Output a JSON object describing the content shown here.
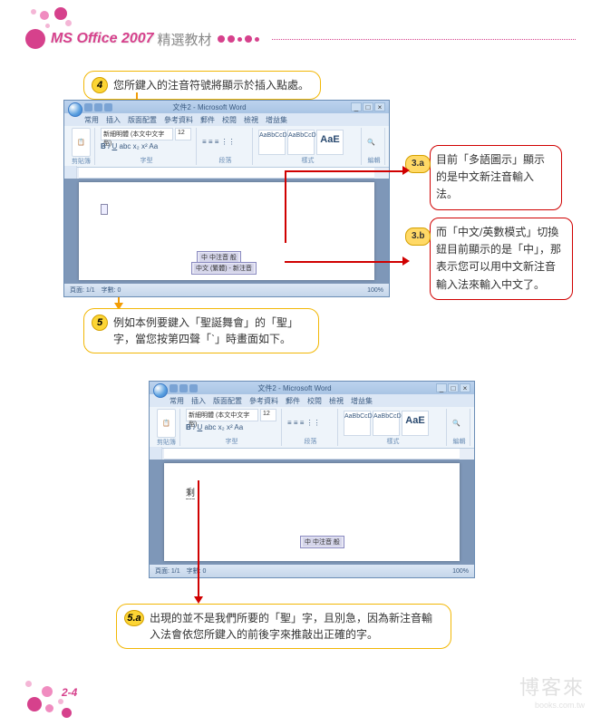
{
  "header": {
    "title_en": "MS Office 2007",
    "title_zh": "精選教材"
  },
  "steps": {
    "s4": {
      "num": "4",
      "text": "您所鍵入的注音符號將顯示於插入點處。"
    },
    "s5": {
      "num": "5",
      "text": "例如本例要鍵入「聖誕舞會」的「聖」字，當您按第四聲「ˋ」時畫面如下。"
    },
    "s5a": {
      "num": "5.a",
      "text": "出現的並不是我們所要的「聖」字，且別急，因為新注音輸入法會依您所鍵入的前後字來推敲出正確的字。"
    }
  },
  "callouts": {
    "c3a": {
      "tag": "3.a",
      "text": "目前「多語圖示」顯示的是中文新注音輸入法。"
    },
    "c3b": {
      "tag": "3.b",
      "text": "而「中文/英數模式」切換鈕目前顯示的是「中」，那表示您可以用中文新注音輸入法來輸入中文了。"
    }
  },
  "word": {
    "app_title": "文件2 - Microsoft Word",
    "tabs": [
      "常用",
      "插入",
      "版面配置",
      "參考資料",
      "郵件",
      "校閱",
      "檢視",
      "增益集"
    ],
    "font_box": "新細明體 (本文中文字型)",
    "font_size": "12",
    "paste_label": "貼上",
    "group_clipboard": "剪貼簿",
    "group_font": "字型",
    "group_para": "段落",
    "group_styles": "樣式",
    "group_edit": "編輯",
    "style_chip": "AaBbCcD",
    "style_big": "AaE",
    "status_left": "頁面: 1/1　字數: 0",
    "status_right": "100%",
    "ime_text1": "中 中注音 般",
    "ime_text2": "中文 (繁體) - 新注音",
    "doc2_char": "剩"
  },
  "page_num": "2-4",
  "watermark": {
    "zh": "博客來",
    "en": "books.com.tw"
  }
}
